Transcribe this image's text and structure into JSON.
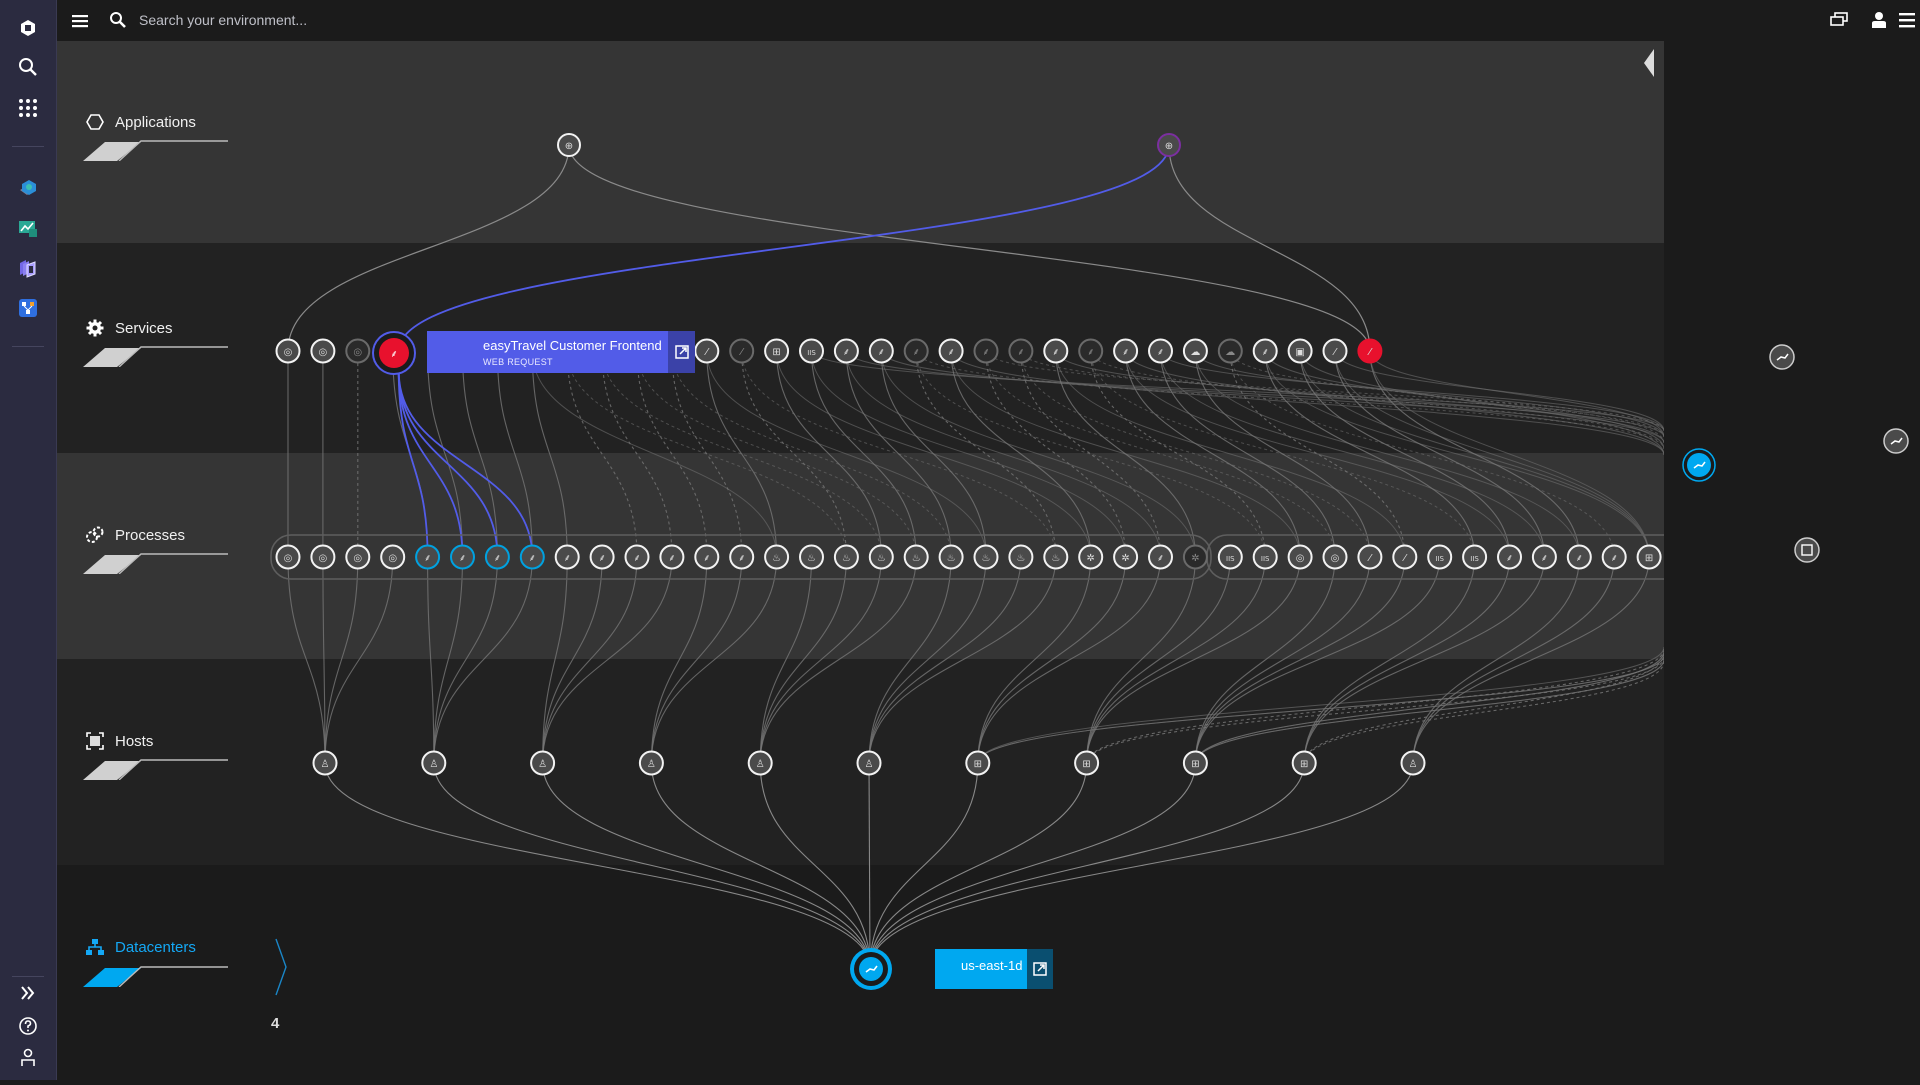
{
  "sidebar": {
    "items": [
      {
        "name": "dynatrace-logo-icon",
        "label": "Home"
      },
      {
        "name": "search-icon",
        "label": "Search"
      },
      {
        "name": "apps-grid-icon",
        "label": "Apps"
      },
      {
        "name": "smartscape-icon",
        "label": "Smartscape topology"
      },
      {
        "name": "dashboard-app-icon",
        "label": "Dashboards"
      },
      {
        "name": "cube-stack-icon",
        "label": "Kubernetes"
      },
      {
        "name": "topology-app-icon",
        "label": "Topology"
      }
    ],
    "bottom": [
      {
        "name": "expand-icon",
        "label": "Expand"
      },
      {
        "name": "help-icon",
        "label": "Help"
      },
      {
        "name": "user-icon",
        "label": "User"
      }
    ]
  },
  "topbar": {
    "search_placeholder": "Search your environment...",
    "search_value": ""
  },
  "layers": {
    "applications": {
      "label": "Applications"
    },
    "services": {
      "label": "Services"
    },
    "processes": {
      "label": "Processes"
    },
    "hosts": {
      "label": "Hosts"
    },
    "datacenters": {
      "label": "Datacenters",
      "count": "4"
    }
  },
  "selected_service": {
    "title": "easyTravel Customer Frontend",
    "subtitle": "WEB REQUEST"
  },
  "selected_datacenter": {
    "title": "us-east-1d"
  },
  "colors": {
    "accent_blue": "#00a1e0",
    "selection_purple": "#525ce8",
    "problem_red": "#e8112d",
    "sidebar_bg": "#2b2b40"
  },
  "nodes": {
    "applications": [
      {
        "icon": "globe",
        "style": "normal"
      },
      {
        "icon": "globe",
        "style": "purple"
      }
    ],
    "services": [
      "db",
      "db",
      "db-dim",
      "selected",
      "db",
      "db",
      "db",
      "feather",
      "feather-dim",
      "feather-dim",
      "feather-dim",
      "feather-dim",
      "feather",
      "feather-dim",
      "grid",
      "iis",
      "net",
      "net",
      "net-dim",
      "net",
      "net-dim",
      "net-dim",
      "net",
      "net-dim",
      "net",
      "net",
      "cloud",
      "cloud-dim",
      "net",
      "floppy",
      "feather",
      "feather-red"
    ],
    "processes": [
      "db",
      "db",
      "db",
      "db",
      "net-blue",
      "net-blue",
      "net-blue",
      "net-blue",
      "net",
      "net",
      "net",
      "net",
      "net",
      "net",
      "java",
      "java",
      "java",
      "java",
      "java",
      "java",
      "java",
      "java",
      "java",
      "gear",
      "gear",
      "net",
      "gear-dim",
      "iis",
      "iis",
      "db",
      "db",
      "feather",
      "feather",
      "iis",
      "iis",
      "net",
      "net",
      "net",
      "net",
      "windows"
    ],
    "hosts": [
      "linux",
      "linux",
      "linux",
      "linux",
      "linux",
      "linux",
      "windows",
      "windows",
      "windows",
      "windows",
      "linux"
    ]
  }
}
